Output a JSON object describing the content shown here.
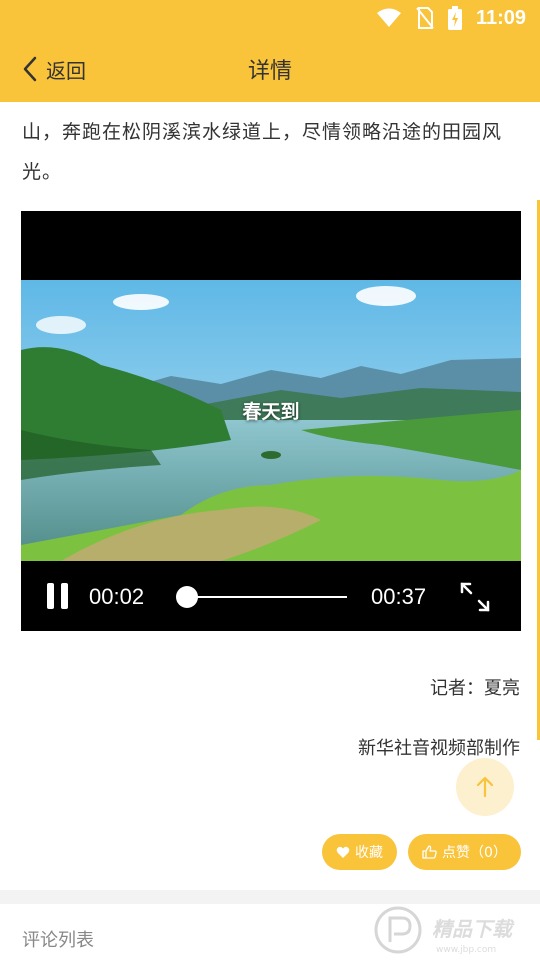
{
  "status_bar": {
    "time": "11:09",
    "icons": [
      "wifi-icon",
      "no-sim-icon",
      "battery-charging-icon"
    ]
  },
  "header": {
    "back_label": "返回",
    "title": "详情"
  },
  "article": {
    "text": "山，奔跑在松阴溪滨水绿道上，尽情领略沿途的田园风光。"
  },
  "video": {
    "caption": "春天到",
    "current_time": "00:02",
    "total_time": "00:37",
    "progress": 0.054,
    "state": "playing"
  },
  "credits": {
    "reporter": "记者：夏亮",
    "producer": "新华社音视频部制作"
  },
  "actions": {
    "favorite_label": "收藏",
    "like_label": "点赞（0）"
  },
  "comments": {
    "header": "评论列表"
  },
  "colors": {
    "accent": "#f9c33a",
    "scroll_top_bg": "#fdf0cf"
  },
  "watermark": {
    "text": "精品下载",
    "url": "www.jbp.com"
  }
}
